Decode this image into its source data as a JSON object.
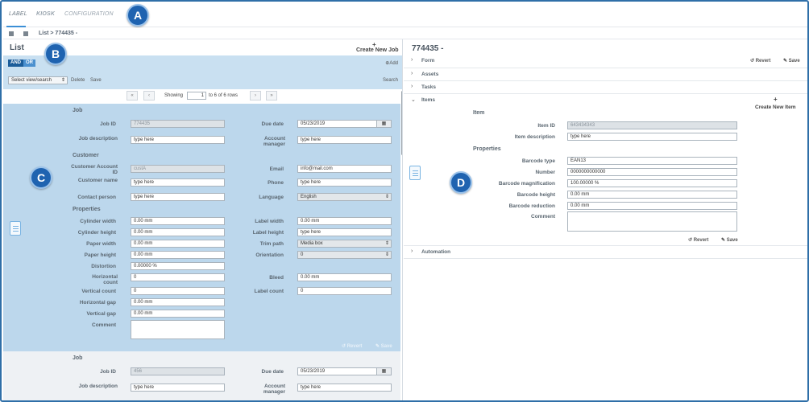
{
  "nav": {
    "tabs": [
      {
        "label": "LABEL"
      },
      {
        "label": "KIOSK"
      },
      {
        "label": "CONFIGURATION"
      }
    ]
  },
  "markers": {
    "a": "A",
    "b": "B",
    "c": "C",
    "d": "D"
  },
  "breadcrumb": {
    "text": "List > 774435 -"
  },
  "list": {
    "title": "List",
    "create_plus": "+",
    "create_label": "Create New Job",
    "filter": {
      "and": "AND",
      "or": "OR",
      "add": "⊕Add",
      "select_view": "Select view/search",
      "delete": "Delete",
      "save": "Save",
      "search": "Search"
    },
    "pager": {
      "first": "«",
      "prev": "‹",
      "next": "›",
      "last": "»",
      "showing": "Showing",
      "page": "1",
      "rows": "to 6 of 6 rows"
    }
  },
  "record1": {
    "sections": {
      "job": "Job",
      "customer": "Customer",
      "properties": "Properties"
    },
    "labels": {
      "job_id": "Job ID",
      "due_date": "Due date",
      "job_description": "Job description",
      "account_manager": "Account manager",
      "customer_account_id": "Customer Account ID",
      "email": "Email",
      "customer_name": "Customer name",
      "phone": "Phone",
      "contact_person": "Contact person",
      "language": "Language",
      "cylinder_width": "Cylinder width",
      "label_width": "Label width",
      "cylinder_height": "Cylinder height",
      "label_height": "Label height",
      "paper_width": "Paper width",
      "trim_path": "Trim path",
      "paper_height": "Paper height",
      "orientation": "Orientation",
      "distortion": "Distortion",
      "horizontal_count": "Horizontal count",
      "bleed": "Bleed",
      "vertical_count": "Vertical count",
      "label_count": "Label count",
      "horizontal_gap": "Horizontal gap",
      "vertical_gap": "Vertical gap",
      "comment": "Comment"
    },
    "values": {
      "job_id": "774435",
      "due_date": "05/23/2019",
      "job_description": "type here",
      "account_manager": "type here",
      "customer_account_id": "custA",
      "email": "info@mail.com",
      "customer_name": "type here",
      "phone": "type here",
      "contact_person": "type here",
      "language": "English",
      "cylinder_width": "0.00 mm",
      "label_width": "0.00 mm",
      "cylinder_height": "0.00 mm",
      "label_height": "type here",
      "paper_width": "0.00 mm",
      "trim_path": "Media box",
      "paper_height": "0.00 mm",
      "orientation": "0",
      "distortion": "0.00000 %",
      "horizontal_count": "0",
      "bleed": "0.00 mm",
      "vertical_count": "0",
      "label_count": "0",
      "horizontal_gap": "0.00 mm",
      "vertical_gap": "0.00 mm"
    },
    "revert": "↺ Revert",
    "save": "✎ Save"
  },
  "record2": {
    "section": "Job",
    "labels": {
      "job_id": "Job ID",
      "due_date": "Due date",
      "job_description": "Job description",
      "account_manager": "Account manager"
    },
    "values": {
      "job_id": "456",
      "due_date": "05/23/2019",
      "job_description": "type here",
      "account_manager": "type here"
    }
  },
  "detail": {
    "title": "774435 -",
    "form": "Form",
    "revert": "↺ Revert",
    "save": "✎ Save",
    "assets": "Assets",
    "tasks": "Tasks",
    "items": "Items",
    "create_item_plus": "+",
    "create_item": "Create New Item",
    "item_section": "Item",
    "properties_section": "Properties",
    "labels": {
      "item_id": "Item ID",
      "item_description": "Item description",
      "barcode_type": "Barcode type",
      "number": "Number",
      "barcode_magnification": "Barcode magnification",
      "barcode_height": "Barcode height",
      "barcode_reduction": "Barcode reduction",
      "comment": "Comment"
    },
    "values": {
      "item_id": "643434343",
      "item_description": "type here",
      "barcode_type": "EAN13",
      "number": "0000000000000",
      "barcode_magnification": "100.00000 %",
      "barcode_height": "0.00 mm",
      "barcode_reduction": "0.00 mm"
    },
    "item_revert": "↺ Revert",
    "item_save": "✎ Save",
    "automation": "Automation"
  }
}
